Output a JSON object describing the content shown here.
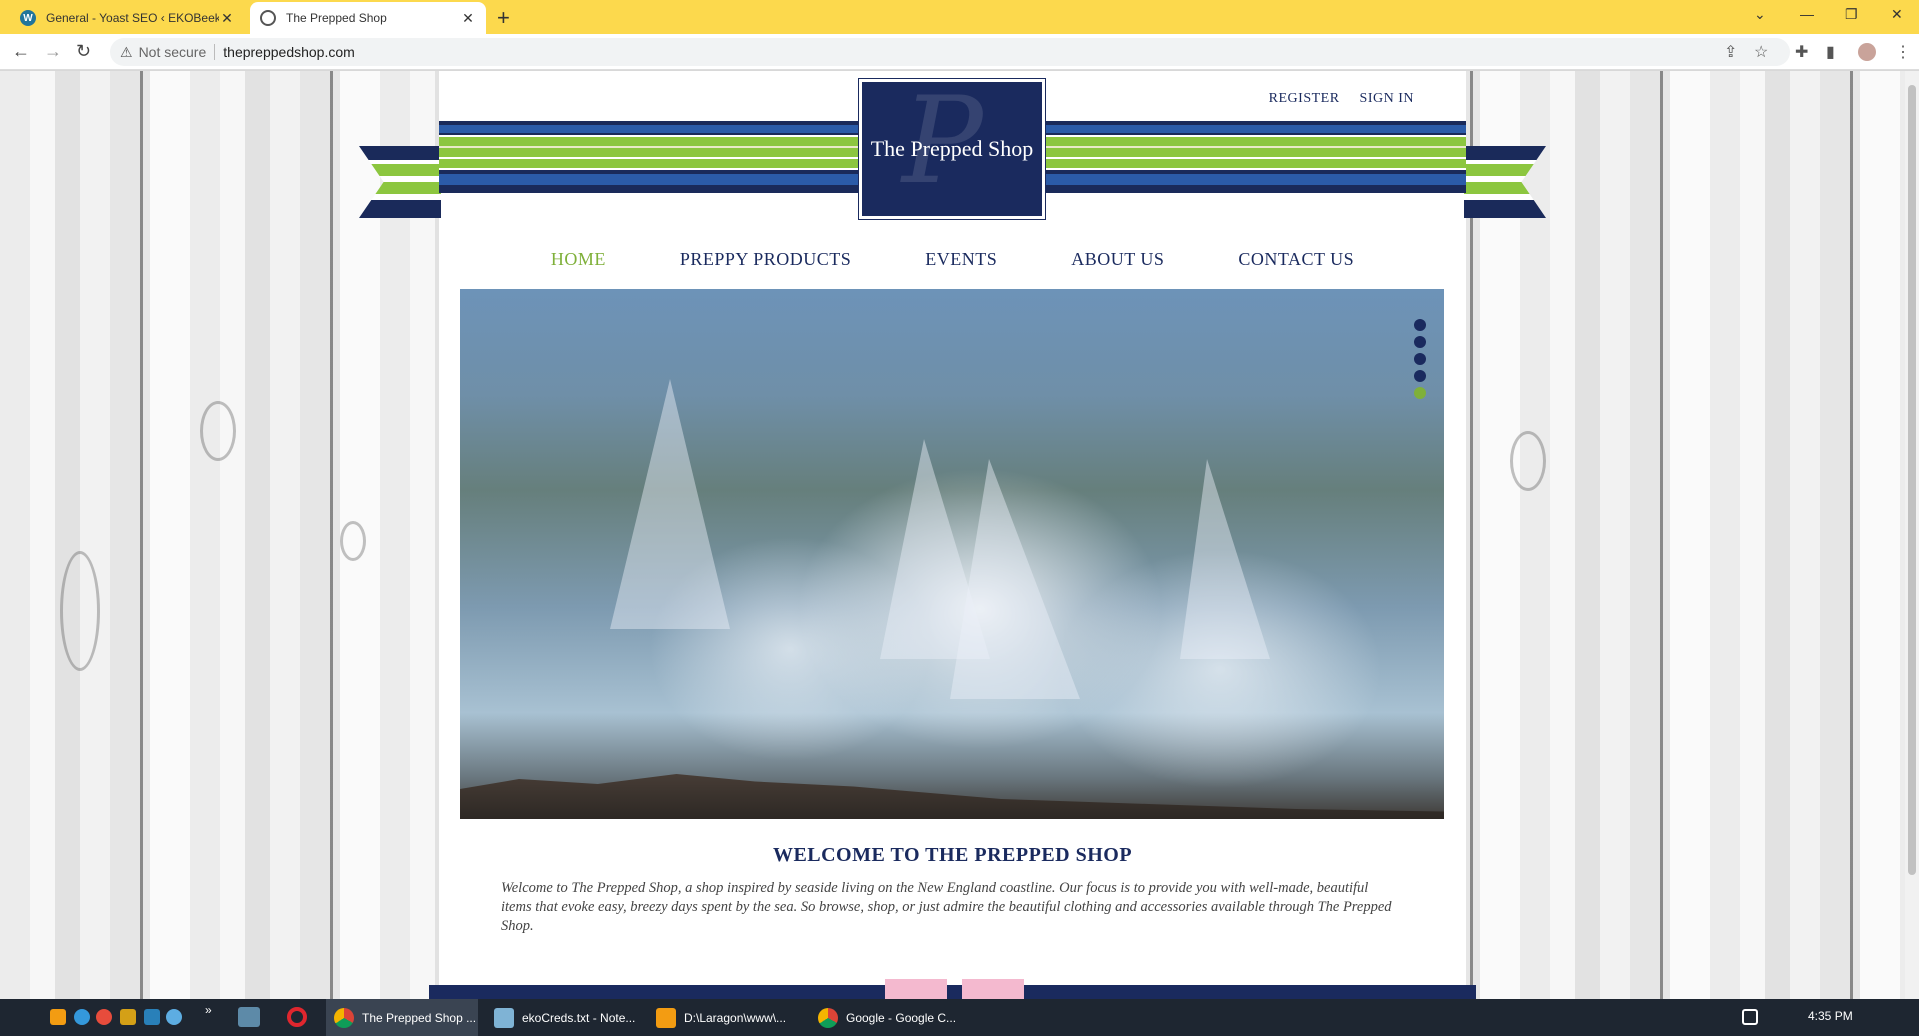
{
  "browser": {
    "tabs": [
      {
        "title": "General - Yoast SEO ‹ EKOBeekee",
        "active": false,
        "favicon": "wordpress-icon"
      },
      {
        "title": "The Prepped Shop",
        "active": true,
        "favicon": "globe-icon"
      }
    ],
    "security_label": "Not secure",
    "url": "thepreppedshop.com"
  },
  "site": {
    "logo_text": "The Prepped Shop",
    "logo_monogram": "P",
    "top_links": {
      "register": "REGISTER",
      "sign_in": "SIGN IN"
    },
    "nav": [
      {
        "label": "HOME",
        "active": true
      },
      {
        "label": "PREPPY PRODUCTS",
        "active": false
      },
      {
        "label": "EVENTS",
        "active": false
      },
      {
        "label": "ABOUT US",
        "active": false
      },
      {
        "label": "CONTACT US",
        "active": false
      }
    ],
    "slider": {
      "slide_count": 5,
      "current_slide": 5
    },
    "welcome_title": "WELCOME TO THE PREPPED SHOP",
    "welcome_text": "Welcome to The Prepped Shop, a shop inspired by seaside living on the New England coastline. Our focus is to provide you with well-made, beautiful items that evoke easy, breezy days spent by the sea. So browse, shop, or just admire the beautiful clothing and accessories available through The Prepped Shop."
  },
  "colors": {
    "navy": "#1a2a5e",
    "green": "#7fb03a",
    "browser_tab_bar": "#fcd94d",
    "taskbar": "#1e2631"
  },
  "taskbar": {
    "apps": [
      {
        "label": "The Prepped Shop ...",
        "active": true
      },
      {
        "label": "ekoCreds.txt - Note...",
        "active": false
      },
      {
        "label": "D:\\Laragon\\www\\...",
        "active": false
      },
      {
        "label": "Google - Google C...",
        "active": false
      }
    ],
    "overflow": "»",
    "clock": "4:35 PM"
  }
}
